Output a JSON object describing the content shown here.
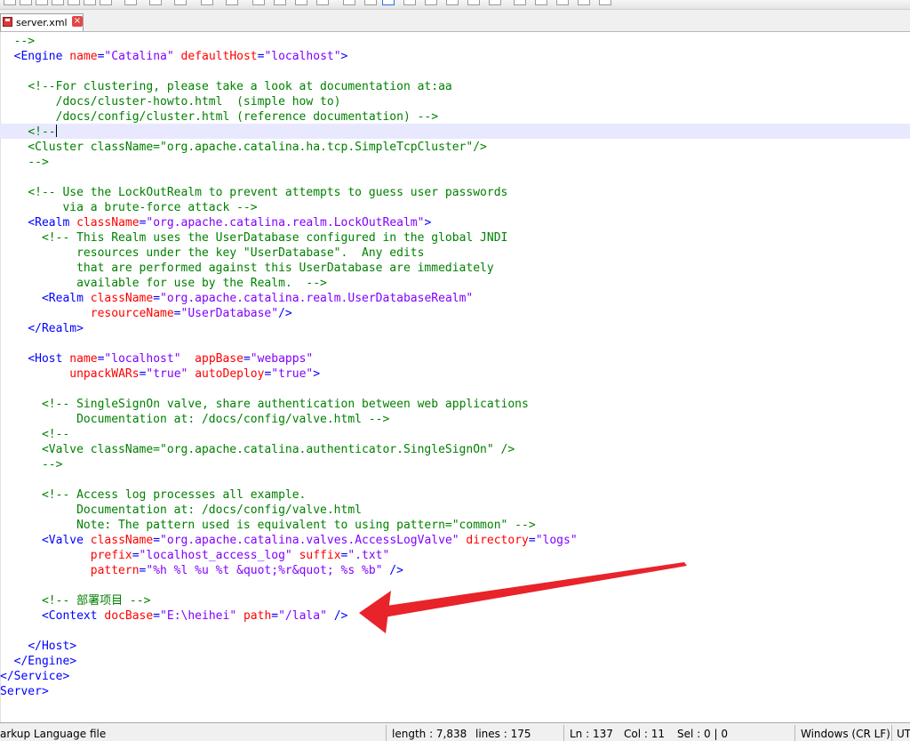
{
  "tab": {
    "label": "server.xml",
    "close": "×"
  },
  "lines": [
    [
      [
        "cm",
        "  -->"
      ]
    ],
    [
      [
        "bk",
        "  "
      ],
      [
        "tg",
        "<Engine "
      ],
      [
        "at",
        "name"
      ],
      [
        "tg",
        "="
      ],
      [
        "vl",
        "\"Catalina\""
      ],
      [
        "tg",
        " "
      ],
      [
        "at",
        "defaultHost"
      ],
      [
        "tg",
        "="
      ],
      [
        "vl",
        "\"localhost\""
      ],
      [
        "tg",
        ">"
      ]
    ],
    [
      [
        "bk",
        ""
      ]
    ],
    [
      [
        "bk",
        "    "
      ],
      [
        "cm",
        "<!--For clustering, please take a look at documentation at:aa"
      ]
    ],
    [
      [
        "cm",
        "        /docs/cluster-howto.html  (simple how to)"
      ]
    ],
    [
      [
        "cm",
        "        /docs/config/cluster.html (reference documentation) -->"
      ]
    ],
    [
      [
        "bk",
        "    "
      ],
      [
        "cm",
        "<!--"
      ]
    ],
    [
      [
        "cm",
        "    <Cluster className=\"org.apache.catalina.ha.tcp.SimpleTcpCluster\"/>"
      ]
    ],
    [
      [
        "cm",
        "    -->"
      ]
    ],
    [
      [
        "bk",
        ""
      ]
    ],
    [
      [
        "bk",
        "    "
      ],
      [
        "cm",
        "<!-- Use the LockOutRealm to prevent attempts to guess user passwords"
      ]
    ],
    [
      [
        "cm",
        "         via a brute-force attack -->"
      ]
    ],
    [
      [
        "bk",
        "    "
      ],
      [
        "tg",
        "<Realm "
      ],
      [
        "at",
        "className"
      ],
      [
        "tg",
        "="
      ],
      [
        "vl",
        "\"org.apache.catalina.realm.LockOutRealm\""
      ],
      [
        "tg",
        ">"
      ]
    ],
    [
      [
        "bk",
        "      "
      ],
      [
        "cm",
        "<!-- This Realm uses the UserDatabase configured in the global JNDI"
      ]
    ],
    [
      [
        "cm",
        "           resources under the key \"UserDatabase\".  Any edits"
      ]
    ],
    [
      [
        "cm",
        "           that are performed against this UserDatabase are immediately"
      ]
    ],
    [
      [
        "cm",
        "           available for use by the Realm.  -->"
      ]
    ],
    [
      [
        "bk",
        "      "
      ],
      [
        "tg",
        "<Realm "
      ],
      [
        "at",
        "className"
      ],
      [
        "tg",
        "="
      ],
      [
        "vl",
        "\"org.apache.catalina.realm.UserDatabaseRealm\""
      ]
    ],
    [
      [
        "bk",
        "             "
      ],
      [
        "at",
        "resourceName"
      ],
      [
        "tg",
        "="
      ],
      [
        "vl",
        "\"UserDatabase\""
      ],
      [
        "tg",
        "/>"
      ]
    ],
    [
      [
        "bk",
        "    "
      ],
      [
        "tg",
        "</Realm>"
      ]
    ],
    [
      [
        "bk",
        ""
      ]
    ],
    [
      [
        "bk",
        "    "
      ],
      [
        "tg",
        "<Host "
      ],
      [
        "at",
        "name"
      ],
      [
        "tg",
        "="
      ],
      [
        "vl",
        "\"localhost\""
      ],
      [
        "tg",
        "  "
      ],
      [
        "at",
        "appBase"
      ],
      [
        "tg",
        "="
      ],
      [
        "vl",
        "\"webapps\""
      ]
    ],
    [
      [
        "bk",
        "          "
      ],
      [
        "at",
        "unpackWARs"
      ],
      [
        "tg",
        "="
      ],
      [
        "vl",
        "\"true\""
      ],
      [
        "tg",
        " "
      ],
      [
        "at",
        "autoDeploy"
      ],
      [
        "tg",
        "="
      ],
      [
        "vl",
        "\"true\""
      ],
      [
        "tg",
        ">"
      ]
    ],
    [
      [
        "bk",
        ""
      ]
    ],
    [
      [
        "bk",
        "      "
      ],
      [
        "cm",
        "<!-- SingleSignOn valve, share authentication between web applications"
      ]
    ],
    [
      [
        "cm",
        "           Documentation at: /docs/config/valve.html -->"
      ]
    ],
    [
      [
        "bk",
        "      "
      ],
      [
        "cm",
        "<!--"
      ]
    ],
    [
      [
        "cm",
        "      <Valve className=\"org.apache.catalina.authenticator.SingleSignOn\" />"
      ]
    ],
    [
      [
        "cm",
        "      -->"
      ]
    ],
    [
      [
        "bk",
        ""
      ]
    ],
    [
      [
        "bk",
        "      "
      ],
      [
        "cm",
        "<!-- Access log processes all example."
      ]
    ],
    [
      [
        "cm",
        "           Documentation at: /docs/config/valve.html"
      ]
    ],
    [
      [
        "cm",
        "           Note: The pattern used is equivalent to using pattern=\"common\" -->"
      ]
    ],
    [
      [
        "bk",
        "      "
      ],
      [
        "tg",
        "<Valve "
      ],
      [
        "at",
        "className"
      ],
      [
        "tg",
        "="
      ],
      [
        "vl",
        "\"org.apache.catalina.valves.AccessLogValve\""
      ],
      [
        "tg",
        " "
      ],
      [
        "at",
        "directory"
      ],
      [
        "tg",
        "="
      ],
      [
        "vl",
        "\"logs\""
      ]
    ],
    [
      [
        "bk",
        "             "
      ],
      [
        "at",
        "prefix"
      ],
      [
        "tg",
        "="
      ],
      [
        "vl",
        "\"localhost_access_log\""
      ],
      [
        "tg",
        " "
      ],
      [
        "at",
        "suffix"
      ],
      [
        "tg",
        "="
      ],
      [
        "vl",
        "\".txt\""
      ]
    ],
    [
      [
        "bk",
        "             "
      ],
      [
        "at",
        "pattern"
      ],
      [
        "tg",
        "="
      ],
      [
        "vl",
        "\"%h %l %u %t &quot;%r&quot; %s %b\""
      ],
      [
        "tg",
        " />"
      ]
    ],
    [
      [
        "bk",
        ""
      ]
    ],
    [
      [
        "bk",
        "      "
      ],
      [
        "cm",
        "<!-- 部署项目 -->"
      ]
    ],
    [
      [
        "bk",
        "      "
      ],
      [
        "tg",
        "<Context "
      ],
      [
        "at",
        "docBase"
      ],
      [
        "tg",
        "="
      ],
      [
        "vl",
        "\"E:\\heihei\""
      ],
      [
        "tg",
        " "
      ],
      [
        "at",
        "path"
      ],
      [
        "tg",
        "="
      ],
      [
        "vl",
        "\"/lala\""
      ],
      [
        "tg",
        " />"
      ]
    ],
    [
      [
        "bk",
        ""
      ]
    ],
    [
      [
        "bk",
        "    "
      ],
      [
        "tg",
        "</Host>"
      ]
    ],
    [
      [
        "bk",
        "  "
      ],
      [
        "tg",
        "</Engine>"
      ]
    ],
    [
      [
        "tg",
        "</Service>"
      ]
    ],
    [
      [
        "tg",
        "Server>"
      ]
    ]
  ],
  "status": {
    "filetype": "arkup Language file",
    "length": "length : 7,838",
    "lines": "lines : 175",
    "ln": "Ln : 137",
    "col": "Col : 11",
    "sel": "Sel : 0 | 0",
    "eol": "Windows (CR LF)",
    "enc": "UT"
  },
  "colors": {
    "comment": "#008000",
    "tag": "#0000ff",
    "attribute": "#ff0000",
    "value": "#8000ff",
    "arrow": "#e8232a"
  }
}
